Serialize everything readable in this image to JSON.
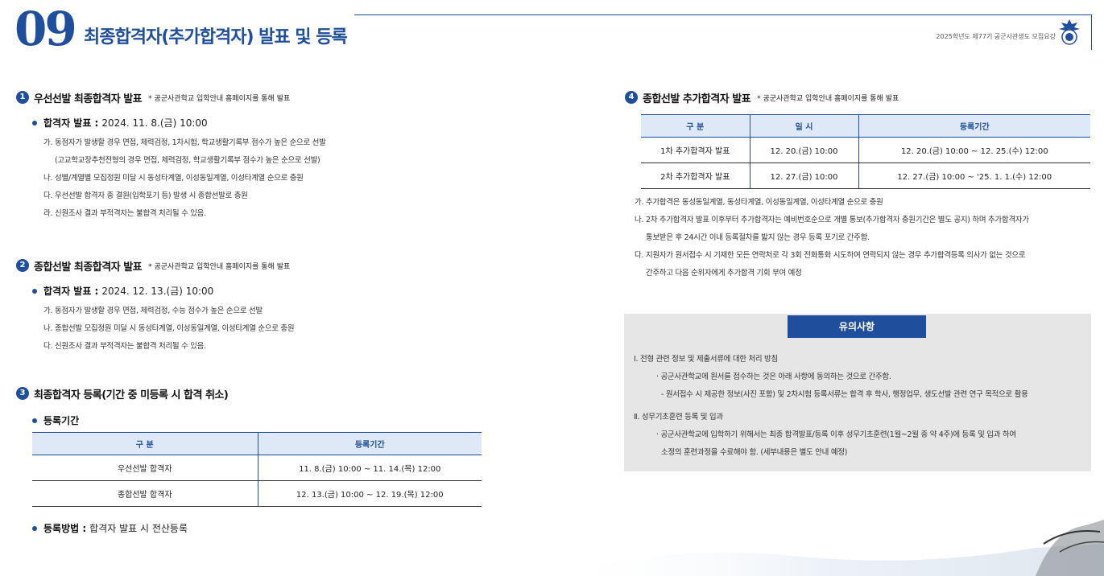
{
  "header": {
    "chapter_number": "09",
    "chapter_title": "최종합격자(추가합격자) 발표 및 등록",
    "doc_note": "2025학년도 제77기 공군사관생도 모집요강"
  },
  "sec1": {
    "num": "1",
    "title": "우선선발 최종합격자 발표",
    "note": "* 공군사관학교 입학안내 홈페이지를 통해 발표",
    "bullet_label": "합격자 발표 :",
    "bullet_value": "2024. 11. 8.(금) 10:00",
    "items": [
      {
        "mark": "가.",
        "text": "동점자가 발생할 경우 면접, 체력검정, 1차시험, 학교생활기록부 점수가 높은 순으로 선발\n(고교학교장추천전형의 경우 면접, 체력검정, 학교생활기록부 점수가 높은 순으로 선발)"
      },
      {
        "mark": "나.",
        "text": "성별/계열별 모집정원 미달 시 동성타계열, 이성동일계열, 이성타계열 순으로 충원"
      },
      {
        "mark": "다.",
        "text": "우선선발 합격자 중 결원(입학포기 등) 발생 시 종합선발로 충원"
      },
      {
        "mark": "라.",
        "text": "신원조사 결과 부적격자는 불합격 처리될 수 있음."
      }
    ]
  },
  "sec2": {
    "num": "2",
    "title": "종합선발 최종합격자 발표",
    "note": "* 공군사관학교 입학안내 홈페이지를 통해 발표",
    "bullet_label": "합격자 발표 :",
    "bullet_value": "2024. 12. 13.(금) 10:00",
    "items": [
      {
        "mark": "가.",
        "text": "동점자가 발생할 경우 면접, 체력검정, 수능 점수가 높은 순으로 선발"
      },
      {
        "mark": "나.",
        "text": "종합선발 모집정원 미달 시 동성타계열, 이성동일계열, 이성타계열 순으로 충원"
      },
      {
        "mark": "다.",
        "text": "신원조사 결과 부적격자는 불합격 처리될 수 있음."
      }
    ]
  },
  "sec3": {
    "num": "3",
    "title": "최종합격자 등록(기간 중 미등록 시 합격 취소)",
    "bullet1_label": "등록기간",
    "table": {
      "headers": [
        "구 분",
        "등록기간"
      ],
      "rows": [
        [
          "우선선발 합격자",
          "11. 8.(금) 10:00 ~ 11. 14.(목) 12:00"
        ],
        [
          "종합선발 합격자",
          "12. 13.(금) 10:00 ~ 12. 19.(목) 12:00"
        ]
      ]
    },
    "bullet2_label": "등록방법 :",
    "bullet2_value": "합격자 발표 시 전산등록"
  },
  "sec4": {
    "num": "4",
    "title": "종합선발 추가합격자 발표",
    "note": "* 공군사관학교 입학안내 홈페이지를 통해 발표",
    "table": {
      "headers": [
        "구 분",
        "일 시",
        "등록기간"
      ],
      "rows": [
        [
          "1차 추가합격자 발표",
          "12. 20.(금) 10:00",
          "12. 20.(금) 10:00 ~ 12. 25.(수) 12:00"
        ],
        [
          "2차 추가합격자 발표",
          "12. 27.(금) 10:00",
          "12. 27.(금) 10:00 ~ '25. 1. 1.(수) 12:00"
        ]
      ]
    },
    "items": [
      {
        "mark": "가.",
        "text": "추가합격은 동성동일계열, 동성타계열, 이성동일계열, 이성타계열 순으로 충원"
      },
      {
        "mark": "나.",
        "text": "2차 추가합격자 발표 이후부터 추가합격자는 예비번호순으로 개별 통보(추가합격자 충원기간은 별도 공지) 하며 추가합격자가\n통보받은 후 24시간 이내 등록절차를 밟지 않는 경우 등록 포기로 간주함."
      },
      {
        "mark": "다.",
        "text": "지원자가 원서접수 시 기재한 모든 연락처로 각 3회 전화통화 시도하여 연락되지 않는 경우 추가합격등록 의사가 없는 것으로\n간주하고 다음 순위자에게 추가합격 기회 부여 예정"
      }
    ]
  },
  "notice": {
    "title": "유의사항",
    "h1": "Ⅰ. 전형 관련 정보 및 제출서류에 대한 처리 방침",
    "h1_s1": "· 공군사관학교에 원서를 접수하는 것은 아래 사항에 동의하는 것으로 간주함.",
    "h1_s2": "- 원서접수 시 제공한 정보(사진 포함) 및 2차시험 등록서류는 합격 후 학사, 행정업무, 생도선발 관련 연구 목적으로 활용",
    "h2": "Ⅱ. 성무기초훈련 등록 및 입과",
    "h2_s1": "· 공군사관학교에 입학하기 위해서는 최종 합격발표/등록 이후 성무기초훈련(1월~2월 중 약 4주)에 등록 및 입과 하여",
    "h2_s2": "소정의 훈련과정을 수료해야 함. (세부내용은 별도 안내 예정)"
  }
}
